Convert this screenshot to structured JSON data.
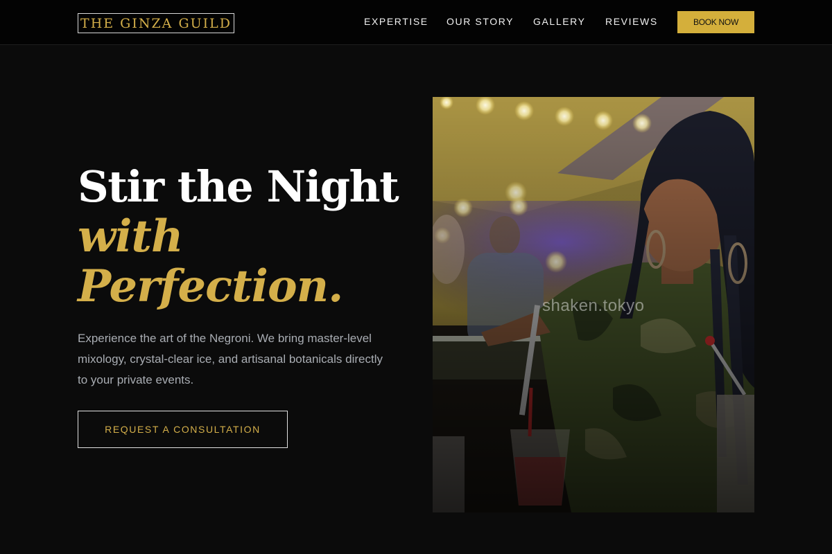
{
  "brand": {
    "name": "THE GINZA GUILD"
  },
  "nav": {
    "items": [
      {
        "label": "EXPERTISE"
      },
      {
        "label": "OUR STORY"
      },
      {
        "label": "GALLERY"
      },
      {
        "label": "REVIEWS"
      }
    ],
    "book_label": "BOOK NOW"
  },
  "hero": {
    "title_line1": "Stir the Night",
    "title_line2": "with",
    "title_line3": "Perfection.",
    "description": "Experience the art of the Negroni. We bring master-level mixology, crystal-clear ice, and artisanal botanicals directly to your private events.",
    "cta_label": "REQUEST A CONSULTATION"
  },
  "photo": {
    "watermark": "shaken.tokyo",
    "subject": "bartender pouring a cocktail at a night event"
  },
  "colors": {
    "accent_gold": "#d4af4a",
    "background": "#0b0b0b",
    "header_bg": "#030303",
    "body_text": "#a9adb3"
  }
}
